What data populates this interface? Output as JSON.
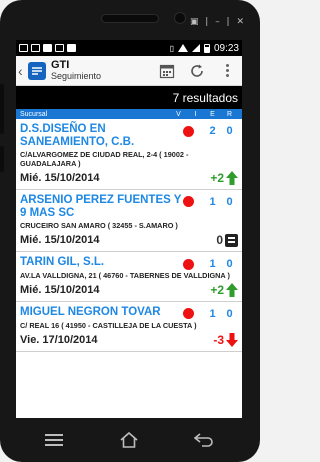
{
  "window_controls": "▣ | – | ✕",
  "statusbar": {
    "time": "09:23"
  },
  "actionbar": {
    "title": "GTI",
    "subtitle": "Seguimiento"
  },
  "results": {
    "label": "7 resultados"
  },
  "list_header": {
    "title": "Sucursal",
    "columns": [
      "V",
      "I",
      "E",
      "R"
    ]
  },
  "rows": [
    {
      "name": "D.S.DISEÑO EN SANEAMIENTO, C.B.",
      "address": "C/ALVARGOMEZ DE CIUDAD REAL, 2-4 ( 19002 - GUADALAJARA )",
      "num1": "2",
      "num2": "0",
      "date": "Mié. 15/10/2014",
      "trend": "+2",
      "trend_dir": "up"
    },
    {
      "name": "ARSENIO PEREZ FUENTES Y 9 MAS SC",
      "address": "CRUCEIRO SAN AMARO ( 32455 - S.AMARO )",
      "num1": "1",
      "num2": "0",
      "date": "Mié. 15/10/2014",
      "trend": "0",
      "trend_dir": "equal"
    },
    {
      "name": "TARIN GIL, S.L.",
      "address": "AV.LA VALLDIGNA, 21 ( 46760 - TABERNES DE VALLDIGNA )",
      "num1": "1",
      "num2": "0",
      "date": "Mié. 15/10/2014",
      "trend": "+2",
      "trend_dir": "up"
    },
    {
      "name": "MIGUEL NEGRON TOVAR",
      "address": "C/ REAL 16 ( 41950 - CASTILLEJA DE LA CUESTA )",
      "num1": "1",
      "num2": "0",
      "date": "Vie. 17/10/2014",
      "trend": "-3",
      "trend_dir": "down"
    }
  ],
  "colors": {
    "accent_blue": "#1e88e5",
    "header_blue": "#1976d2",
    "dot_red": "#ee1111",
    "up_green": "#2e9d2e",
    "down_red": "#ee1111"
  }
}
